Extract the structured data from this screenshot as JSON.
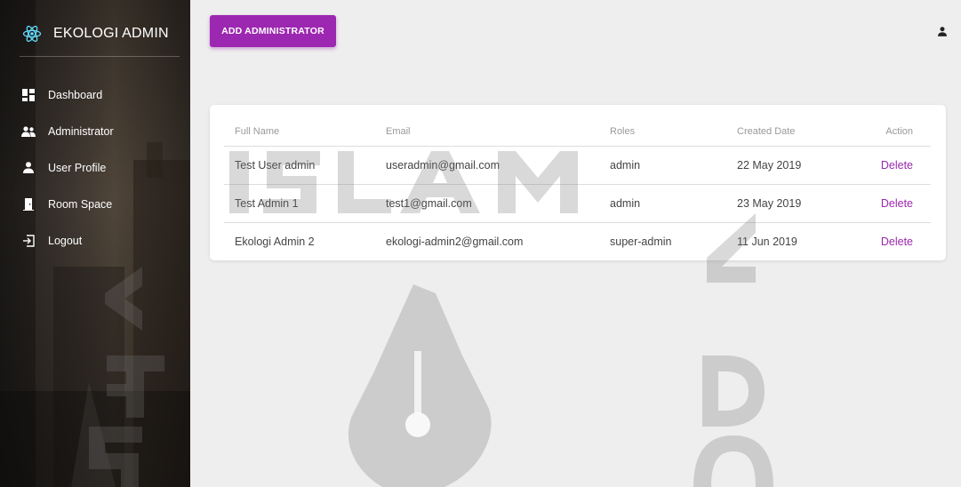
{
  "brand": {
    "title": "EKOLOGI ADMIN",
    "icon": "react-atom-icon"
  },
  "nav": [
    {
      "label": "Dashboard",
      "icon": "dashboard-icon"
    },
    {
      "label": "Administrator",
      "icon": "people-icon"
    },
    {
      "label": "User Profile",
      "icon": "person-icon"
    },
    {
      "label": "Room Space",
      "icon": "door-icon"
    },
    {
      "label": "Logout",
      "icon": "logout-icon"
    }
  ],
  "toolbar": {
    "add_label": "ADD ADMINISTRATOR"
  },
  "table": {
    "headers": [
      "Full Name",
      "Email",
      "Roles",
      "Created Date",
      "Action"
    ],
    "rows": [
      {
        "name": "Test User admin",
        "email": "useradmin@gmail.com",
        "role": "admin",
        "date": "22 May 2019",
        "action": "Delete"
      },
      {
        "name": "Test Admin 1",
        "email": "test1@gmail.com",
        "role": "admin",
        "date": "23 May 2019",
        "action": "Delete"
      },
      {
        "name": "Ekologi Admin 2",
        "email": "ekologi-admin2@gmail.com",
        "role": "super-admin",
        "date": "11 Jun 2019",
        "action": "Delete"
      }
    ]
  },
  "colors": {
    "accent": "#9c27b0",
    "brand_icon": "#61dafb"
  }
}
